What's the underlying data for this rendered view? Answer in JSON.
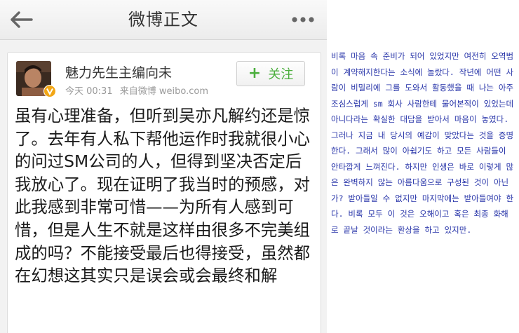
{
  "navbar": {
    "title": "微博正文",
    "back_icon": "arrow-left-icon",
    "more_icon": "more-dots-icon"
  },
  "post": {
    "author": "魅力先生主编向未",
    "verified_icon": "verified-v-icon",
    "time": "今天 00:31",
    "source": "来自微博 weibo.com",
    "follow_label": "关注",
    "text": "虽有心理准备，但听到吴亦凡解约还是惊了。去年有人私下帮他运作时我就很小心的问过SM公司的人，但得到坚决否定后我放心了。现在证明了我当时的预感，对此我感到非常可惜——为所有人感到可惜，但是人生不就是这样由很多不完美组成的吗？不能接受最后也得接受，虽然都在幻想这其实只是误会或会最终和解"
  },
  "translation": {
    "text": "비록 마음 속 준비가 되어 있었지만 여전히 오역범이 계약해지한다는 소식에 놀랐다. 작년에 어떤 사람이 비밀리에 그를 도와서 활동했을 때 나는 아주 조심스럽게 sm 회사 사람한테 물어본적이 있었는데 아니다라는 확실한 대답을 받아서 마음이 놓였다. 그러나 지금 내 당시의 예감이 맞았다는 것을 증명한다. 그래서 많이 아쉽기도 하고 모든 사람들이 안타깝게 느껴진다. 하지만 인생은 바로 이렇게 많은 완벽하지 않는 아름다움으로 구성된 것이 아닌가? 받아들일 수 없지만 마지막에는 받아들여야 한다. 비록 모두 이 것은 오해이고 혹은 최종 화해로 끝날 것이라는 환상을 하고 있지만."
  },
  "colors": {
    "follow_green": "#4caf3e",
    "translation_blue": "#2633a8",
    "verified_gold": "#f2a615"
  }
}
